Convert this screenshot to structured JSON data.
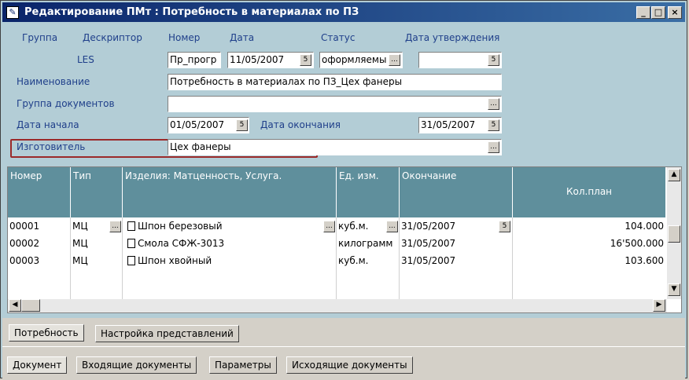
{
  "window": {
    "title": "Редактирование ПМт : Потребность в материалах по ПЗ",
    "min_glyph": "_",
    "max_glyph": "□",
    "close_glyph": "×"
  },
  "header": {
    "labels": {
      "group": "Группа",
      "descriptor": "Дескриптор",
      "number": "Номер",
      "date": "Дата",
      "status": "Статус",
      "approval_date": "Дата утверждения",
      "les": "LES",
      "name": "Наименование",
      "doc_group": "Группа документов",
      "start_date": "Дата начала",
      "end_date": "Дата окончания",
      "manufacturer": "Изготовитель"
    },
    "values": {
      "number": "Пр_прогр",
      "date": "11/05/2007",
      "status": "оформляемы",
      "approval_date": "",
      "name": "Потребность в материалах по ПЗ_Цех фанеры",
      "doc_group": "",
      "start_date": "01/05/2007",
      "end_date": "31/05/2007",
      "manufacturer": "Цех фанеры"
    },
    "glyphs": {
      "calendar": "5",
      "ellipsis": "..."
    }
  },
  "grid": {
    "columns": [
      "Номер",
      "Тип",
      "Изделия: Матценность, Услуга.",
      "Ед. изм.",
      "Окончание",
      "Кол.план"
    ],
    "rows": [
      {
        "number": "00001",
        "type": "МЦ",
        "item": "Шпон березовый",
        "unit": "куб.м.",
        "end": "31/05/2007",
        "qty": "104.000"
      },
      {
        "number": "00002",
        "type": "МЦ",
        "item": "Смола СФЖ-3013",
        "unit": "килограмм",
        "end": "31/05/2007",
        "qty": "16'500.000"
      },
      {
        "number": "00003",
        "type": "МЦ",
        "item": "Шпон хвойный",
        "unit": "куб.м.",
        "end": "31/05/2007",
        "qty": "103.600"
      }
    ],
    "scroll_glyphs": {
      "up": "▲",
      "down": "▼",
      "left": "◀",
      "right": "▶"
    }
  },
  "tabs_top": [
    "Потребность",
    "Настройка представлений"
  ],
  "tabs_bottom": [
    "Документ",
    "Входящие документы",
    "Параметры",
    "Исходящие документы"
  ],
  "colors": {
    "title_bar": "#0a246a",
    "form_bg": "#b3cdd6",
    "grid_header": "#5f8f9c",
    "highlight_border": "#9b2a2a",
    "label_text": "#1f3f8a"
  }
}
